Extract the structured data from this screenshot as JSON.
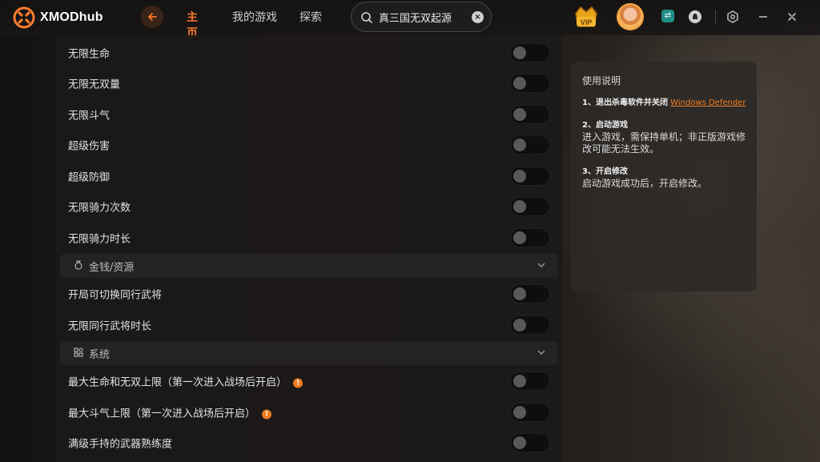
{
  "app": {
    "logo_text": "XMODhub"
  },
  "nav": {
    "items": [
      {
        "label": "主页",
        "active": true
      },
      {
        "label": "我的游戏",
        "active": false
      },
      {
        "label": "探索",
        "active": false
      }
    ]
  },
  "search": {
    "value": "真三国无双起源",
    "placeholder": ""
  },
  "header": {
    "vip_label": "VIP"
  },
  "cheats": {
    "group1": [
      {
        "label": "无限生命",
        "enabled": false
      },
      {
        "label": "无限无双量",
        "enabled": false
      },
      {
        "label": "无限斗气",
        "enabled": false
      },
      {
        "label": "超级伤害",
        "enabled": false
      },
      {
        "label": "超级防御",
        "enabled": false
      },
      {
        "label": "无限骑力次数",
        "enabled": false
      },
      {
        "label": "无限骑力时长",
        "enabled": false
      }
    ],
    "section_money": {
      "label": "金钱/资源"
    },
    "group2": [
      {
        "label": "开局可切换同行武将",
        "enabled": false
      },
      {
        "label": "无限同行武将时长",
        "enabled": false
      }
    ],
    "section_system": {
      "label": "系统"
    },
    "group3": [
      {
        "label": "最大生命和无双上限（第一次进入战场后开启）",
        "enabled": false,
        "info": true
      },
      {
        "label": "最大斗气上限（第一次进入战场后开启）",
        "enabled": false,
        "info": true
      },
      {
        "label": "满级手持的武器熟练度",
        "enabled": false
      }
    ]
  },
  "instructions": {
    "title": "使用说明",
    "step1_head": "1、退出杀毒软件并关闭",
    "step1_link": "Windows Defender",
    "step2_head": "2、启动游戏",
    "step2_text": "进入游戏，需保持单机；非正版游戏修改可能无法生效。",
    "step3_head": "3、开启修改",
    "step3_text": "启动游戏成功后，开启修改。"
  },
  "colors": {
    "accent": "#ff7a2e",
    "panel_bg": "#1c1a19",
    "toggle_off": "#5b5958"
  },
  "icons": {
    "logo": "xmod-logo-icon",
    "back": "arrow-left-icon",
    "search": "search-icon",
    "clear": "close-circle-icon",
    "vip": "vip-crown-icon",
    "switch": "switch-icon",
    "qq": "qq-icon",
    "gear": "gear-icon",
    "minimize": "minimize-icon",
    "close": "close-icon",
    "money": "money-bag-icon",
    "system": "apps-icon",
    "chevron": "chevron-down-icon",
    "info": "info-icon"
  }
}
